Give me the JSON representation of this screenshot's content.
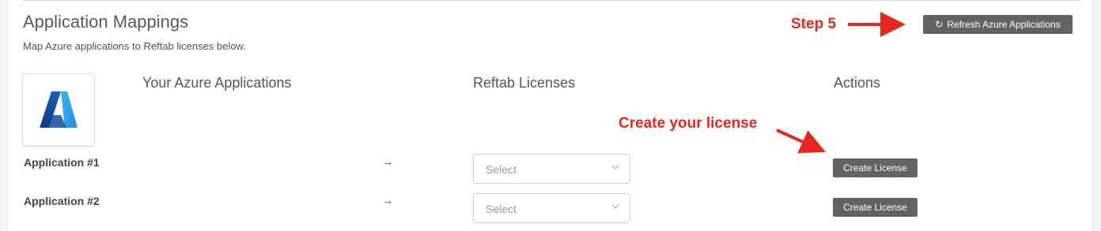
{
  "header": {
    "title": "Application Mappings",
    "subtitle": "Map Azure applications to Reftab licenses below.",
    "refresh_button": "Refresh Azure Applications",
    "refresh_icon": "refresh-icon"
  },
  "annotations": {
    "step5": "Step 5",
    "create_note": "Create your license",
    "color": "#e8281e"
  },
  "logo": {
    "icon": "azure-logo-icon"
  },
  "columns": {
    "azure": "Your Azure Applications",
    "reftab": "Reftab Licenses",
    "actions": "Actions"
  },
  "rows": [
    {
      "name": "Application #1",
      "select_placeholder": "Select",
      "action": "Create License"
    },
    {
      "name": "Application #2",
      "select_placeholder": "Select",
      "action": "Create License"
    }
  ],
  "colors": {
    "button_bg": "#636363",
    "annotation": "#e8281e"
  }
}
